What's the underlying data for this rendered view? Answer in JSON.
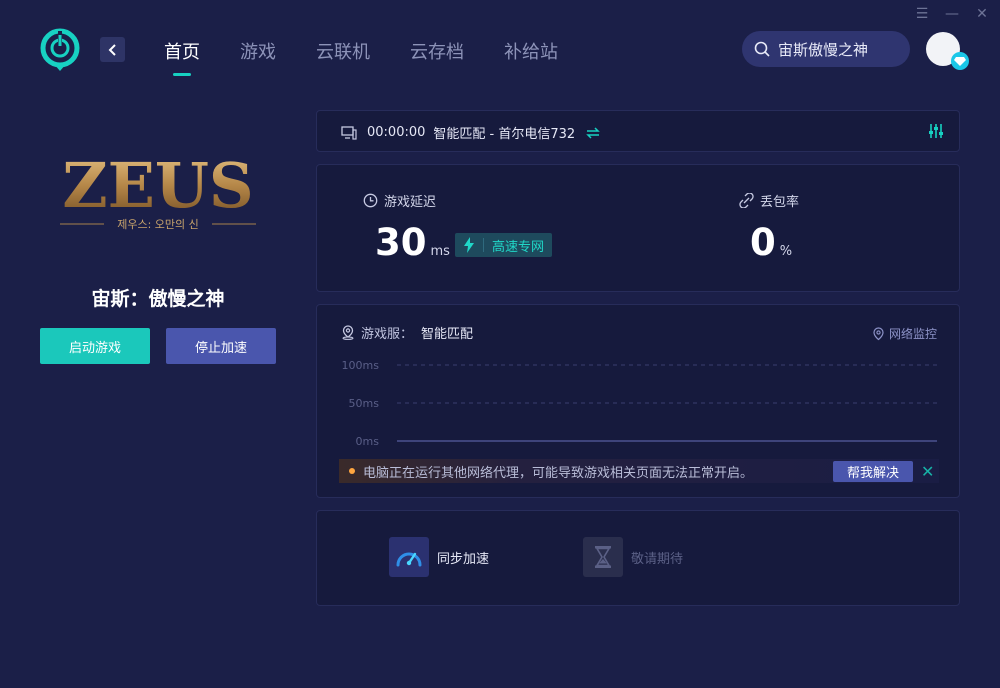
{
  "window": {
    "menu_icon": "menu-icon",
    "min_icon": "minimize-icon",
    "close_icon": "close-icon"
  },
  "nav": {
    "items": [
      {
        "label": "首页",
        "active": true
      },
      {
        "label": "游戏",
        "active": false
      },
      {
        "label": "云联机",
        "active": false
      },
      {
        "label": "云存档",
        "active": false
      },
      {
        "label": "补给站",
        "active": false
      }
    ]
  },
  "search": {
    "text": "宙斯傲慢之神"
  },
  "game": {
    "logo_text": "ZEUS",
    "logo_sub": "제우스: 오만의 신",
    "title": "宙斯：傲慢之神",
    "start_label": "启动游戏",
    "stop_label": "停止加速"
  },
  "connection": {
    "time": "00:00:00",
    "route": "智能匹配 - 首尔电信732"
  },
  "metrics": {
    "latency_label": "游戏延迟",
    "latency_value": "30",
    "latency_unit": "ms",
    "badge_label": "高速专网",
    "loss_label": "丢包率",
    "loss_value": "0",
    "loss_unit": "%"
  },
  "server": {
    "label": "游戏服：",
    "value": "智能匹配",
    "monitor_label": "网络监控"
  },
  "chart_data": {
    "type": "line",
    "y_ticks": [
      "100ms",
      "50ms",
      "0ms"
    ],
    "ylim": [
      0,
      100
    ],
    "series": [
      {
        "values": [
          0,
          0
        ]
      }
    ]
  },
  "warning": {
    "text": "电脑正在运行其他网络代理，可能导致游戏相关页面无法正常开启。",
    "help_label": "帮我解决",
    "close_label": "✕"
  },
  "features": [
    {
      "label": "同步加速",
      "enabled": true
    },
    {
      "label": "敬请期待",
      "enabled": false
    }
  ],
  "colors": {
    "accent": "#1bc8bb",
    "primary_btn": "#4a56ad",
    "bg": "#1b1f48",
    "panel": "#161a3d"
  }
}
